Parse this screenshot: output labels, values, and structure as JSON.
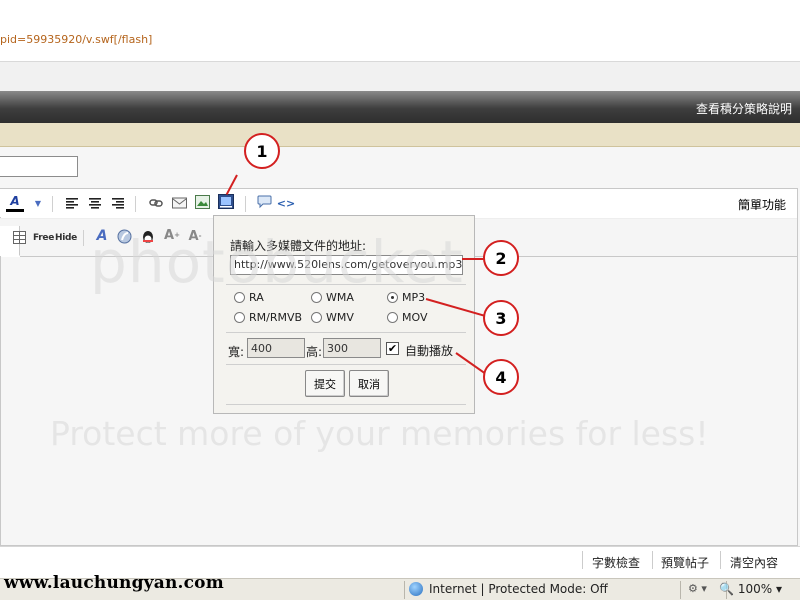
{
  "url_fragment": "pid=59935920/v.swf[/flash]",
  "header": {
    "right_link": "查看積分策略說明"
  },
  "toolbar": {
    "simple_mode": "簡單功能",
    "free_label": "Free",
    "hide_label": "Hide"
  },
  "popup": {
    "label": "請輸入多媒體文件的地址:",
    "url_value": "http://www.520lens.com/getoveryou.mp3",
    "formats": [
      {
        "label": "RA",
        "selected": false
      },
      {
        "label": "WMA",
        "selected": false
      },
      {
        "label": "MP3",
        "selected": true
      },
      {
        "label": "RM/RMVB",
        "selected": false
      },
      {
        "label": "WMV",
        "selected": false
      },
      {
        "label": "MOV",
        "selected": false
      }
    ],
    "width_label": "寬:",
    "width_value": "400",
    "height_label": "高:",
    "height_value": "300",
    "autoplay_checked": true,
    "autoplay_label": "自動播放",
    "submit_label": "提交",
    "cancel_label": "取消"
  },
  "callouts": [
    "1",
    "2",
    "3",
    "4"
  ],
  "footer": {
    "links": [
      "字數檢查",
      "預覽帖子",
      "清空內容"
    ]
  },
  "status": {
    "site_watermark": "www.lauchungyan.com",
    "zone": "Internet | Protected Mode: Off",
    "zoom": "100%"
  },
  "watermarks": {
    "brand": "photobucket",
    "tagline": "Protect more of your memories for less!"
  },
  "colors": {
    "link": "#b5651d",
    "callout_red": "#d32020",
    "header_dark": "#3e3e3e",
    "tan_bar": "#e9e1c6"
  }
}
